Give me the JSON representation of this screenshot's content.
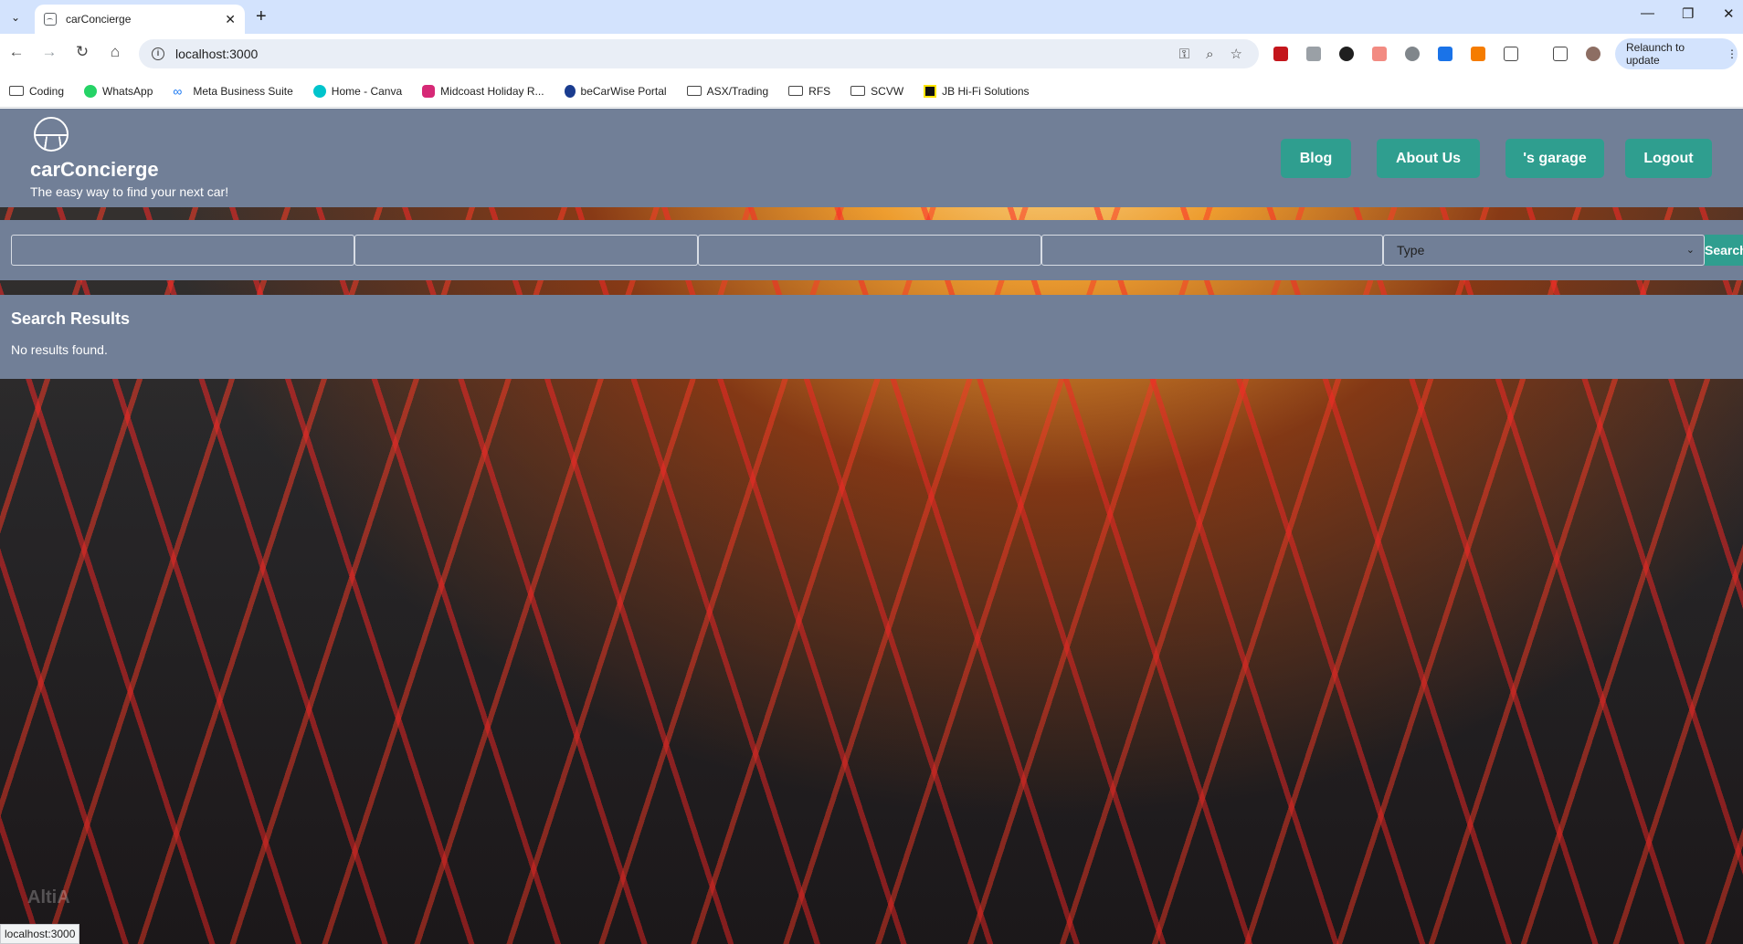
{
  "tab": {
    "title": "carConcierge"
  },
  "omnibox": {
    "url": "localhost:3000"
  },
  "relaunch_label": "Relaunch to update",
  "bookmarks": [
    {
      "label": "Coding",
      "icon": "folder-icon"
    },
    {
      "label": "WhatsApp",
      "icon": "whatsapp-icon"
    },
    {
      "label": "Meta Business Suite",
      "icon": "meta-icon"
    },
    {
      "label": "Home - Canva",
      "icon": "canva-icon"
    },
    {
      "label": "Midcoast Holiday R...",
      "icon": "instagram-icon"
    },
    {
      "label": "beCarWise Portal",
      "icon": "becarwise-icon"
    },
    {
      "label": "ASX/Trading",
      "icon": "folder-icon"
    },
    {
      "label": "RFS",
      "icon": "folder-icon"
    },
    {
      "label": "SCVW",
      "icon": "folder-icon"
    },
    {
      "label": "JB Hi-Fi Solutions",
      "icon": "jbhifi-icon"
    }
  ],
  "site": {
    "brand": "carConcierge",
    "tagline": "The easy way to find your next car!",
    "nav": [
      "Blog",
      "About Us",
      "'s garage",
      "Logout"
    ]
  },
  "search": {
    "type_placeholder": "Type",
    "button_label": "Search"
  },
  "results": {
    "title": "Search Results",
    "empty_message": "No results found."
  },
  "status_url": "localhost:3000",
  "colors": {
    "panel": "#717f97",
    "accent": "#2f9e8f",
    "tabstrip": "#d3e3fd"
  }
}
